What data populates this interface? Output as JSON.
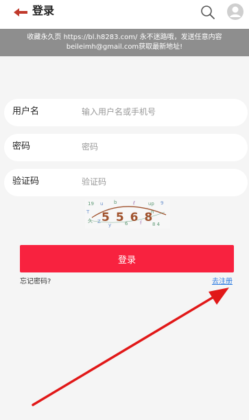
{
  "header": {
    "title": "登录",
    "back_icon": "arrow-left-icon",
    "search_icon": "search-icon",
    "avatar_icon": "user-avatar-icon",
    "accent_color": "#c0392b"
  },
  "notice": {
    "line1": "收藏永久页 https://bl.h8283.com/ 永不迷路哦，发送任意内容",
    "line2": "beileimh@gmail.com获取最新地址!"
  },
  "form": {
    "username": {
      "label": "用户名",
      "placeholder": "输入用户名或手机号"
    },
    "password": {
      "label": "密码",
      "placeholder": "密码"
    },
    "captcha": {
      "label": "验证码",
      "placeholder": "验证码",
      "image_text": "5568"
    },
    "login_label": "登录",
    "login_color": "#f8223f",
    "forgot_label": "忘记密码?",
    "register_label": "去注册"
  }
}
